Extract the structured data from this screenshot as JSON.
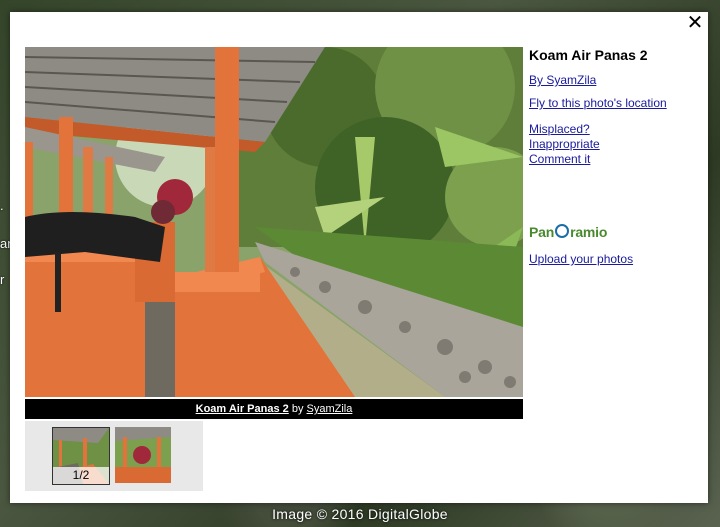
{
  "photo": {
    "title": "Koam Air Panas 2",
    "author": "SyamZila",
    "author_link": "By SyamZila",
    "caption_sep": "by",
    "fly_link": "Fly to this photo's location",
    "misplaced": "Misplaced?",
    "inappropriate": "Inappropriate",
    "comment": "Comment it",
    "upload": "Upload your photos",
    "logo_pre": "Pan",
    "logo_post": "ramio"
  },
  "gallery": {
    "counter": "1/2"
  },
  "map": {
    "imagery": "Image © 2016 DigitalGlobe",
    "bg_t1": ".",
    "bg_t2": "ar",
    "bg_t3": "r"
  },
  "controls": {
    "close_glyph": "✕"
  },
  "colors": {
    "accent_link": "#1a1a9c",
    "brand_green": "#4a8a2e",
    "brand_blue": "#1d6ca8",
    "pillar_orange": "#e2733a"
  }
}
